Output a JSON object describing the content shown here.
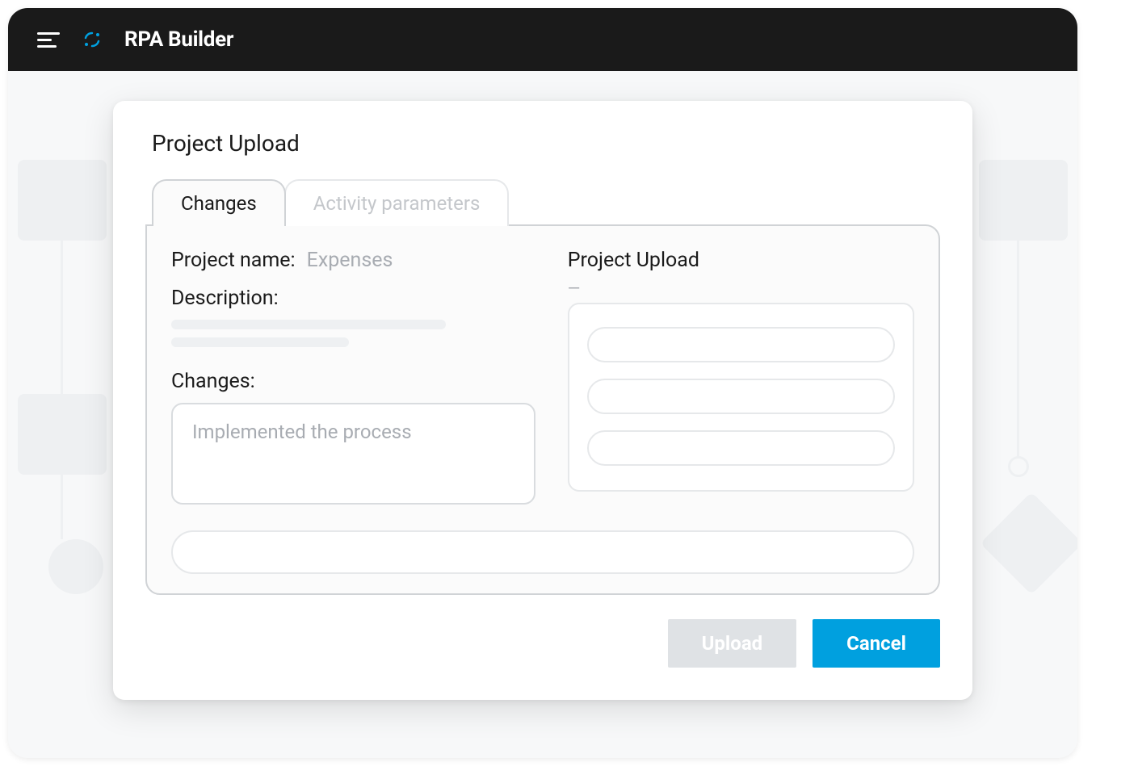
{
  "header": {
    "app_title": "RPA Builder"
  },
  "dialog": {
    "title": "Project Upload",
    "tabs": {
      "changes": "Changes",
      "activity_params": "Activity parameters"
    },
    "fields": {
      "project_name_label": "Project name:",
      "project_name_value": "Expenses",
      "description_label": "Description:",
      "changes_label": "Changes:",
      "changes_value": "Implemented the process"
    },
    "right_panel": {
      "heading": "Project Upload"
    },
    "buttons": {
      "upload": "Upload",
      "cancel": "Cancel"
    }
  }
}
